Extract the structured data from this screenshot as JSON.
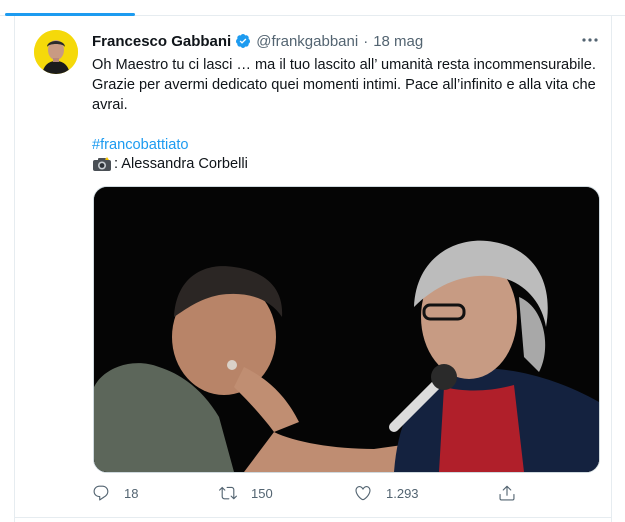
{
  "tweet": {
    "author_name": "Francesco Gabbani",
    "handle": "@frankgabbani",
    "separator": "·",
    "date": "18 mag",
    "text": "Oh Maestro tu ci lasci … ma il tuo lascito all’ umanità resta incommensurabile. Grazie per avermi dedicato quei momenti intimi. Pace all’infinito e alla vita che avrai.",
    "hashtag": "#francobattiato",
    "credit": ": Alessandra Corbelli",
    "replies": "18",
    "retweets": "150",
    "likes": "1.293"
  },
  "icons": {
    "verified": "verified-badge-icon",
    "more": "more-icon",
    "camera": "camera-flash-icon",
    "reply": "reply-icon",
    "retweet": "retweet-icon",
    "like": "heart-icon",
    "share": "share-icon"
  },
  "colors": {
    "accent": "#1d9bf0",
    "secondary_text": "#536471",
    "avatar_bg": "#f5d90a",
    "photo_bg": "#050505"
  }
}
